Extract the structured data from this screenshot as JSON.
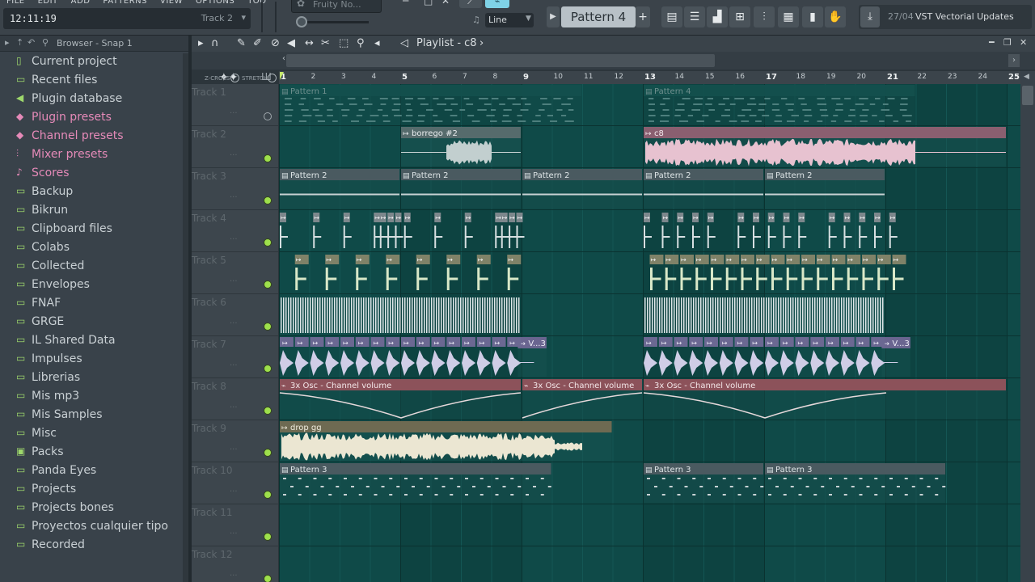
{
  "app": {
    "menu": [
      "FILE",
      "EDIT",
      "ADD",
      "PATTERNS",
      "VIEW",
      "OPTIONS",
      "TOOLS",
      "?"
    ],
    "time": "12:11:19",
    "hint_track": "Track 2",
    "channel_name": "Fruity No...",
    "snap_mode": "Line",
    "pattern": "Pattern 4",
    "news_date": "27/04",
    "news_text": "VST Vectorial Updates"
  },
  "browser": {
    "title": "Browser - Snap 1",
    "items": [
      {
        "label": "Current project",
        "icon": "project-icon",
        "special": false
      },
      {
        "label": "Recent files",
        "icon": "folder-icon",
        "special": false
      },
      {
        "label": "Plugin database",
        "icon": "plugin-icon",
        "special": false
      },
      {
        "label": "Plugin presets",
        "icon": "preset-icon",
        "special": true
      },
      {
        "label": "Channel presets",
        "icon": "preset-icon",
        "special": true
      },
      {
        "label": "Mixer presets",
        "icon": "mixer-icon",
        "special": true
      },
      {
        "label": "Scores",
        "icon": "note-icon",
        "special": true
      },
      {
        "label": "Backup",
        "icon": "folder-icon",
        "special": false
      },
      {
        "label": "Bikrun",
        "icon": "folder-icon",
        "special": false
      },
      {
        "label": "Clipboard files",
        "icon": "folder-icon",
        "special": false
      },
      {
        "label": "Colabs",
        "icon": "folder-icon",
        "special": false
      },
      {
        "label": "Collected",
        "icon": "folder-icon",
        "special": false
      },
      {
        "label": "Envelopes",
        "icon": "folder-icon",
        "special": false
      },
      {
        "label": "FNAF",
        "icon": "folder-icon",
        "special": false
      },
      {
        "label": "GRGE",
        "icon": "folder-icon",
        "special": false
      },
      {
        "label": "IL Shared Data",
        "icon": "folder-icon",
        "special": false
      },
      {
        "label": "Impulses",
        "icon": "folder-icon",
        "special": false
      },
      {
        "label": "Librerias",
        "icon": "folder-icon",
        "special": false
      },
      {
        "label": "Mis mp3",
        "icon": "folder-icon",
        "special": false
      },
      {
        "label": "Mis Samples",
        "icon": "folder-icon",
        "special": false
      },
      {
        "label": "Misc",
        "icon": "folder-icon",
        "special": false
      },
      {
        "label": "Packs",
        "icon": "pack-icon",
        "special": false
      },
      {
        "label": "Panda Eyes",
        "icon": "folder-icon",
        "special": false
      },
      {
        "label": "Projects",
        "icon": "folder-icon",
        "special": false
      },
      {
        "label": "Projects bones",
        "icon": "folder-icon",
        "special": false
      },
      {
        "label": "Proyectos cualquier tipo",
        "icon": "folder-icon",
        "special": false
      },
      {
        "label": "Recorded",
        "icon": "folder-icon",
        "special": false
      }
    ]
  },
  "playlist": {
    "title": "Playlist - c8",
    "zcross_label": "Z-CROSS",
    "stretch_label": "STRETCH",
    "ruler": [
      "1",
      "2",
      "3",
      "4",
      "5",
      "6",
      "7",
      "8",
      "9",
      "10",
      "11",
      "12",
      "13",
      "14",
      "15",
      "16",
      "17",
      "18",
      "19",
      "20",
      "21",
      "22",
      "23",
      "24",
      "25"
    ],
    "tracks": [
      {
        "name": "Track 1",
        "dots": "...",
        "muted": true
      },
      {
        "name": "Track 2",
        "dots": "...",
        "muted": false
      },
      {
        "name": "Track 3",
        "dots": "...",
        "muted": false
      },
      {
        "name": "Track 4",
        "dots": "...",
        "muted": false
      },
      {
        "name": "Track 5",
        "dots": "...",
        "muted": false
      },
      {
        "name": "Track 6",
        "dots": "...",
        "muted": false
      },
      {
        "name": "Track 7",
        "dots": "...",
        "muted": false
      },
      {
        "name": "Track 8",
        "dots": "...",
        "muted": false
      },
      {
        "name": "Track 9",
        "dots": "...",
        "muted": false
      },
      {
        "name": "Track 10",
        "dots": "...",
        "muted": false
      },
      {
        "name": "Track 11",
        "dots": "...",
        "muted": false
      },
      {
        "name": "Track 12",
        "dots": "...",
        "muted": false
      }
    ],
    "clips": [
      {
        "track": 0,
        "start": 1,
        "len": 10,
        "label": "Pattern 1",
        "kind": "pattern-muted"
      },
      {
        "track": 0,
        "start": 13,
        "len": 9,
        "label": "Pattern 4",
        "kind": "pattern-muted"
      },
      {
        "track": 1,
        "start": 5,
        "len": 4,
        "label": "borrego #2",
        "kind": "audio-gray"
      },
      {
        "track": 1,
        "start": 13,
        "len": 12,
        "label": "c8",
        "kind": "audio-pink"
      },
      {
        "track": 2,
        "start": 1,
        "len": 4,
        "label": "Pattern 2",
        "kind": "pattern"
      },
      {
        "track": 2,
        "start": 5,
        "len": 4,
        "label": "Pattern 2",
        "kind": "pattern"
      },
      {
        "track": 2,
        "start": 9,
        "len": 4,
        "label": "Pattern 2",
        "kind": "pattern"
      },
      {
        "track": 2,
        "start": 13,
        "len": 4,
        "label": "Pattern 2",
        "kind": "pattern"
      },
      {
        "track": 2,
        "start": 17,
        "len": 4,
        "label": "Pattern 2",
        "kind": "pattern"
      },
      {
        "track": 6,
        "start": 8.85,
        "len": 1,
        "label": "V...3",
        "kind": "audio-purple-label"
      },
      {
        "track": 6,
        "start": 20.85,
        "len": 1,
        "label": "V...3",
        "kind": "audio-purple-label"
      },
      {
        "track": 7,
        "start": 1,
        "len": 8,
        "label": "3x Osc - Channel volume",
        "kind": "automation"
      },
      {
        "track": 7,
        "start": 9,
        "len": 4,
        "label": "3x Osc - Channel volume",
        "kind": "automation"
      },
      {
        "track": 7,
        "start": 13,
        "len": 12,
        "label": "3x Osc - Channel volume",
        "kind": "automation"
      },
      {
        "track": 8,
        "start": 1,
        "len": 11,
        "label": "drop gg",
        "kind": "audio-cream"
      },
      {
        "track": 9,
        "start": 1,
        "len": 9,
        "label": "Pattern 3",
        "kind": "pattern"
      },
      {
        "track": 9,
        "start": 13,
        "len": 4,
        "label": "Pattern 3",
        "kind": "pattern"
      },
      {
        "track": 9,
        "start": 17,
        "len": 6,
        "label": "Pattern 3",
        "kind": "pattern"
      }
    ]
  }
}
